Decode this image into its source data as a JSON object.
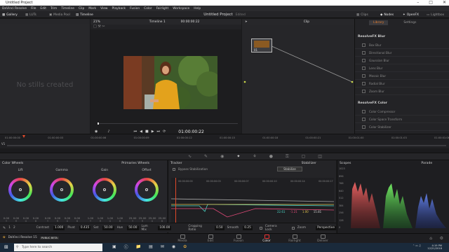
{
  "window": {
    "title": "Untitled Project"
  },
  "menu": [
    "DaVinci Resolve",
    "File",
    "Edit",
    "Trim",
    "Timeline",
    "Clip",
    "Mark",
    "View",
    "Playback",
    "Fusion",
    "Color",
    "Fairlight",
    "Workspace",
    "Help"
  ],
  "toolbar": {
    "left": [
      {
        "label": "Gallery",
        "icon": "gallery-icon",
        "active": true
      },
      {
        "label": "LUTs",
        "icon": "lut-icon",
        "active": false
      },
      {
        "label": "Media Pool",
        "icon": "media-pool-icon",
        "active": false
      },
      {
        "label": "Timeline",
        "icon": "timeline-icon",
        "active": true
      }
    ],
    "project_title": "Untitled Project",
    "project_status": "Edited",
    "right": [
      {
        "label": "Clips",
        "icon": "clips-icon",
        "active": false
      },
      {
        "label": "Nodes",
        "icon": "nodes-icon",
        "active": true
      },
      {
        "label": "OpenFX",
        "icon": "openfx-icon",
        "active": true
      },
      {
        "label": "Lightbox",
        "icon": "lightbox-icon",
        "active": false
      }
    ]
  },
  "gallery": {
    "empty_text": "No stills created"
  },
  "viewer": {
    "zoom": "21%",
    "timeline_name": "Timeline 1",
    "timecode_top": "00:00:00:22",
    "timecode": "01:00:00:22"
  },
  "nodes": {
    "mode": "Clip",
    "node_label": "01"
  },
  "openfx": {
    "tabs": [
      "Library",
      "Settings"
    ],
    "active_tab": "Library",
    "groups": [
      {
        "title": "ResolveFX Blur",
        "items": [
          "Box Blur",
          "Directional Blur",
          "Gaussian Blur",
          "Lens Blur",
          "Mosaic Blur",
          "Radial Blur",
          "Zoom Blur"
        ]
      },
      {
        "title": "ResolveFX Color",
        "items": [
          "Color Compressor",
          "Color Space Transform",
          "Color Stabilizer"
        ]
      }
    ]
  },
  "timeline": {
    "ticks": [
      "01:00:00:00",
      "01:00:00:03",
      "01:00:00:06",
      "01:00:00:09",
      "01:00:00:12",
      "01:00:00:15",
      "01:00:00:18",
      "01:00:00:21",
      "01:00:01:00",
      "01:00:01:03",
      "01:00:01:06"
    ],
    "clip_label": "V1"
  },
  "color_wheels": {
    "title": "Color Wheels",
    "mode": "Primaries Wheels",
    "wheels": [
      {
        "name": "Lift",
        "values": [
          "0.00",
          "0.00",
          "0.00",
          "0.00"
        ]
      },
      {
        "name": "Gamma",
        "values": [
          "0.00",
          "0.00",
          "0.00",
          "0.00"
        ]
      },
      {
        "name": "Gain",
        "values": [
          "1.00",
          "1.00",
          "1.00",
          "1.00"
        ]
      },
      {
        "name": "Offset",
        "values": [
          "25.00",
          "25.00",
          "25.00",
          "25.00"
        ]
      }
    ],
    "channels": [
      "Y",
      "R",
      "G",
      "B"
    ]
  },
  "tracker": {
    "title": "Tracker",
    "mode": "Stabilizer",
    "option": "Bypass Stabilization",
    "button": "Stabilize",
    "timecodes": [
      "00:00:00:00",
      "00:00:00:03",
      "00:00:00:07",
      "00:00:00:10",
      "00:00:00:14",
      "00:00:00:17"
    ],
    "readouts": [
      "22.61",
      "-1.21",
      "1.00",
      "15.81"
    ],
    "params": [
      {
        "label": "Cropping Ratio",
        "value": "0.50"
      },
      {
        "label": "Smooth",
        "value": "0.25"
      }
    ],
    "checks": [
      {
        "label": "Camera Lock"
      },
      {
        "label": "Zoom"
      }
    ],
    "select": "Perspective"
  },
  "scopes": {
    "title": "Scopes",
    "mode": "Parade",
    "scale": [
      "1023",
      "896",
      "768",
      "640",
      "512",
      "384",
      "256",
      "128",
      "0"
    ]
  },
  "adjust": [
    {
      "label": "Contrast",
      "value": "1.000"
    },
    {
      "label": "Pivot",
      "value": "0.435"
    },
    {
      "label": "Sat",
      "value": "50.00"
    },
    {
      "label": "Hue",
      "value": "50.00"
    },
    {
      "label": "Lum Mix",
      "value": "100.00"
    }
  ],
  "pages": [
    {
      "label": "Media",
      "active": false
    },
    {
      "label": "Edit",
      "active": false
    },
    {
      "label": "Fusion",
      "active": false
    },
    {
      "label": "Color",
      "active": true
    },
    {
      "label": "Fairlight",
      "active": false
    },
    {
      "label": "Deliver",
      "active": false
    }
  ],
  "app_badge": {
    "name": "DaVinci Resolve 15",
    "tag": "PUBLIC BETA"
  },
  "taskbar": {
    "search_placeholder": "Type here to search",
    "time": "4:19 PM",
    "date": "12/21/2018"
  }
}
